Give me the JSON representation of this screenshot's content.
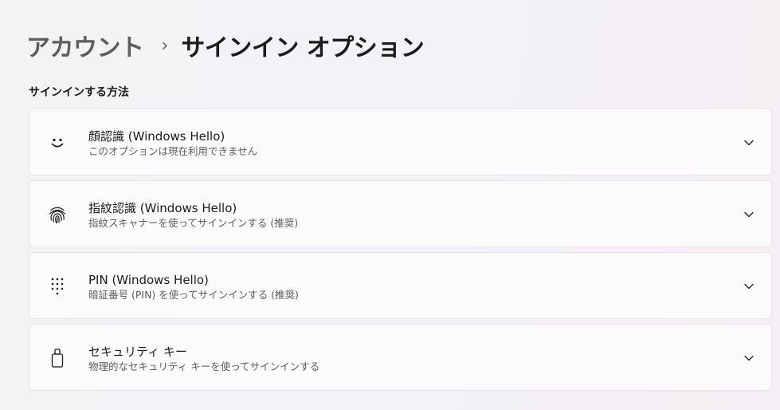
{
  "breadcrumb": {
    "parent": "アカウント",
    "separator": "›",
    "current": "サインイン オプション"
  },
  "section": {
    "title": "サインインする方法"
  },
  "options": [
    {
      "icon": "face-icon",
      "title": "顔認識 (Windows Hello)",
      "subtitle": "このオプションは現在利用できません"
    },
    {
      "icon": "fingerprint-icon",
      "title": "指紋認識 (Windows Hello)",
      "subtitle": "指紋スキャナーを使ってサインインする (推奨)"
    },
    {
      "icon": "keypad-icon",
      "title": "PIN (Windows Hello)",
      "subtitle": "暗証番号 (PIN) を使ってサインインする (推奨)"
    },
    {
      "icon": "security-key-icon",
      "title": "セキュリティ キー",
      "subtitle": "物理的なセキュリティ キーを使ってサインインする"
    }
  ],
  "colors": {
    "text_primary": "#1b1b1b",
    "text_secondary": "#5d5d5d",
    "card_background": "#fbfbfc",
    "card_border": "#e4e4e7"
  }
}
